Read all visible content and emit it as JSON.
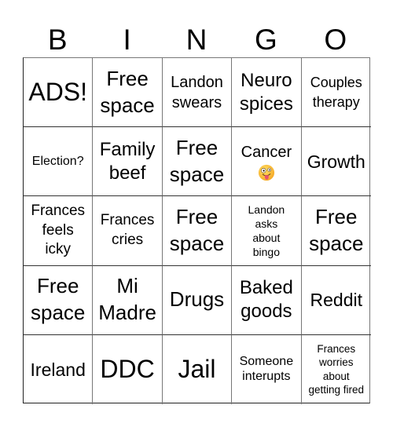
{
  "header": {
    "letters": [
      "B",
      "I",
      "N",
      "G",
      "O"
    ]
  },
  "board": {
    "rows": [
      [
        {
          "text": "ADS!"
        },
        {
          "text": "Free\nspace"
        },
        {
          "text": "Landon\nswears"
        },
        {
          "text": "Neuro\nspices"
        },
        {
          "text": "Couples\ntherapy"
        }
      ],
      [
        {
          "text": "Election?"
        },
        {
          "text": "Family\nbeef"
        },
        {
          "text": "Free\nspace"
        },
        {
          "text": "Cancer",
          "icon": "zany-face-emoji"
        },
        {
          "text": "Growth"
        }
      ],
      [
        {
          "text": "Frances\nfeels\nicky"
        },
        {
          "text": "Frances\ncries"
        },
        {
          "text": "Free\nspace"
        },
        {
          "text": "Landon\nasks\nabout\nbingo"
        },
        {
          "text": "Free\nspace"
        }
      ],
      [
        {
          "text": "Free\nspace"
        },
        {
          "text": "Mi\nMadre"
        },
        {
          "text": "Drugs"
        },
        {
          "text": "Baked\ngoods"
        },
        {
          "text": "Reddit"
        }
      ],
      [
        {
          "text": "Ireland"
        },
        {
          "text": "DDC"
        },
        {
          "text": "Jail"
        },
        {
          "text": "Someone\ninterupts"
        },
        {
          "text": "Frances\nworries\nabout\ngetting fired"
        }
      ]
    ]
  }
}
